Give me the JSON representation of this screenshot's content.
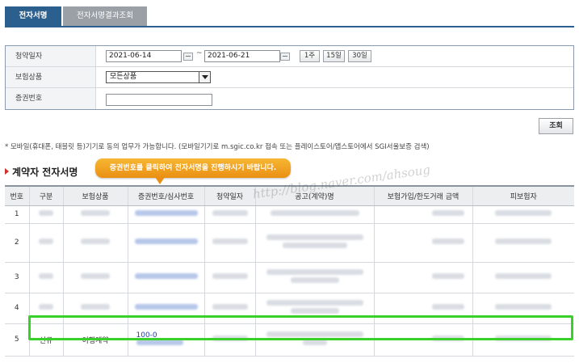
{
  "tabs": [
    {
      "label": "전자서명",
      "active": true
    },
    {
      "label": "전자서명결과조회",
      "active": false
    }
  ],
  "search": {
    "date_label": "청약일자",
    "date_from": "2021-06-14",
    "date_separator": "~",
    "date_to": "2021-06-21",
    "period_buttons": [
      "1주",
      "15일",
      "30일"
    ],
    "product_label": "보험상품",
    "product_selected": "모든상품",
    "policy_label": "증권번호",
    "policy_value": "",
    "search_button": "조회"
  },
  "notice": "* 모바일(휴대폰, 태블릿 등)기기로 동의 업무가 가능합니다. (모바일기기로 m.sgic.co.kr 접속 또는 플레이스토어/앱스토어에서 SGI서울보증 검색)",
  "section_title": "계약자 전자서명",
  "tooltip": "증권번호를 클릭하여 전자서명을 진행하시기 바랍니다.",
  "watermark": "http://blog.naver.com/ahsoug",
  "table": {
    "columns": [
      "번호",
      "구분",
      "보험상품",
      "증권번호/심사번호",
      "청약일자",
      "공고(계약)명",
      "보험가입/한도거래 금액",
      "피보험자"
    ],
    "rows": [
      {
        "no": "1",
        "type": "",
        "product": "",
        "policy": ""
      },
      {
        "no": "2",
        "type": "",
        "product": "",
        "policy": ""
      },
      {
        "no": "3",
        "type": "",
        "product": "",
        "policy": ""
      },
      {
        "no": "4",
        "type": "",
        "product": "",
        "policy": ""
      },
      {
        "no": "5",
        "type": "신규",
        "product": "이행계약",
        "policy": "100-0"
      }
    ]
  },
  "colors": {
    "tab_active": "#2a5f8e",
    "tooltip": "#f0a020",
    "highlight": "#3ad02a",
    "link": "#1f3fa6"
  }
}
